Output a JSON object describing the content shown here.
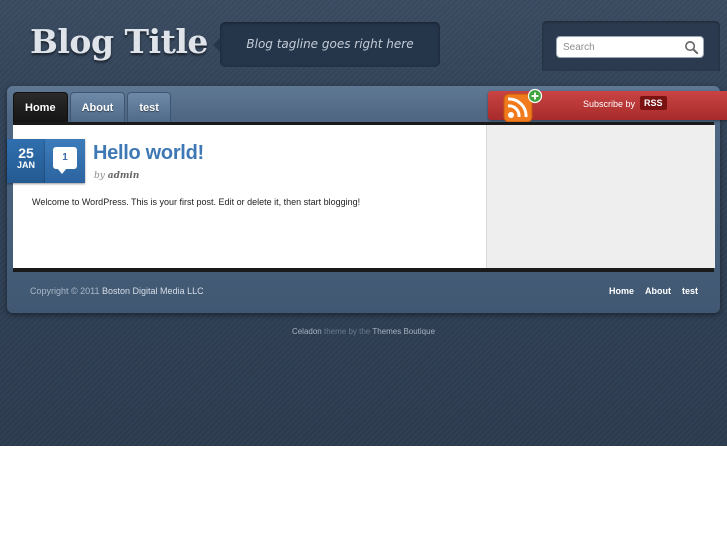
{
  "header": {
    "blog_title": "Blog Title",
    "tagline": "Blog tagline goes right here",
    "search_placeholder": "Search"
  },
  "nav": {
    "items": [
      {
        "label": "Home",
        "active": true
      },
      {
        "label": "About",
        "active": false
      },
      {
        "label": "test",
        "active": false
      }
    ]
  },
  "rss": {
    "label": "Subscribe by",
    "badge": "RSS",
    "color": "#b83333"
  },
  "post": {
    "day": "25",
    "month": "JAN",
    "comment_count": "1",
    "title": "Hello world!",
    "by": "by",
    "author": "admin",
    "body": "Welcome to WordPress. This is your first post. Edit or delete it, then start blogging!"
  },
  "footer": {
    "copyright": "Copyright © 2011",
    "owner": "Boston Digital Media LLC",
    "nav": [
      "Home",
      "About",
      "test"
    ],
    "credit_theme": "Celadon",
    "credit_mid": "theme by the",
    "credit_by": "Themes Boutique"
  },
  "colors": {
    "accent_blue": "#3f79b5",
    "background": "#33445a",
    "rss_red": "#b83333"
  },
  "icons": [
    "search-icon",
    "rss-icon",
    "plus-icon",
    "comment-bubble-icon"
  ]
}
